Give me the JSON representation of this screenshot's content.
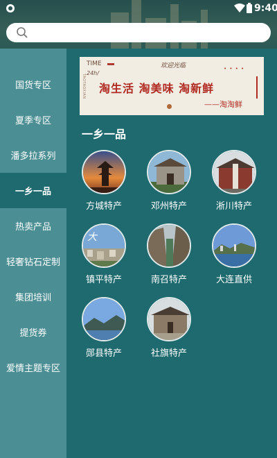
{
  "status_bar": {
    "time": "9:40",
    "icons": [
      "shield-icon",
      "wifi-icon",
      "battery-icon"
    ]
  },
  "search": {
    "placeholder": "",
    "icon": "search-icon"
  },
  "sidebar": {
    "items": [
      {
        "label": "国货专区",
        "active": false
      },
      {
        "label": "夏季专区",
        "active": false
      },
      {
        "label": "潘多拉系列",
        "active": false
      },
      {
        "label": "一乡一品",
        "active": true
      },
      {
        "label": "热卖产品",
        "active": false
      },
      {
        "label": "轻奢钻石定制",
        "active": false
      },
      {
        "label": "集团培训",
        "active": false
      },
      {
        "label": "提货券",
        "active": false
      },
      {
        "label": "爱情主题专区",
        "active": false
      }
    ]
  },
  "banner": {
    "tag": "TIME",
    "small_text": "24h/",
    "vertical_text": "TAOTAOXIAN",
    "welcome": "欢迎光临",
    "dots": "• • • •",
    "headline": "淘生活 淘美味 淘新鲜",
    "signature": "——淘淘鲜"
  },
  "section": {
    "title": "一乡一品"
  },
  "products": [
    {
      "label": "方城特产",
      "image": "pagoda-sunset"
    },
    {
      "label": "邓州特产",
      "image": "gate-archway"
    },
    {
      "label": "淅川特产",
      "image": "temple-statue"
    },
    {
      "label": "镇平特产",
      "image": "town-aerial"
    },
    {
      "label": "南召特产",
      "image": "mountain-canyon"
    },
    {
      "label": "大连直供",
      "image": "coastal-city"
    },
    {
      "label": "郧县特产",
      "image": "lake-mountains"
    },
    {
      "label": "社旗特产",
      "image": "old-street"
    }
  ],
  "colors": {
    "background": "#1f6a6f",
    "sidebar": "#4b8f95",
    "banner_red": "#b02a22"
  }
}
